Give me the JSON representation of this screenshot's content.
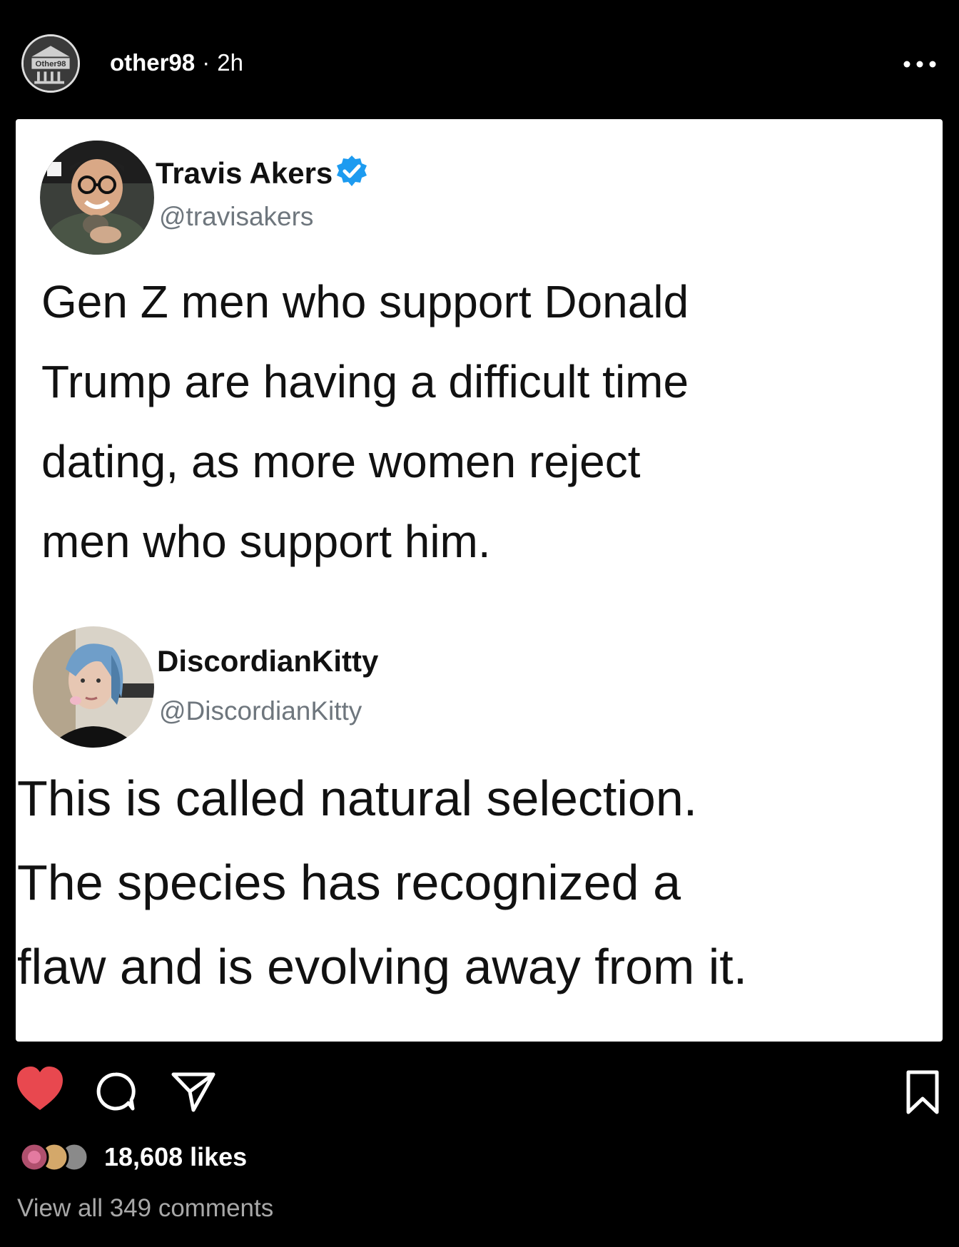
{
  "post": {
    "username": "other98",
    "separator": "·",
    "time_ago": "2h",
    "avatar_text": "Other98"
  },
  "tweets": [
    {
      "name": "Travis Akers",
      "verified": true,
      "handle": "@travisakers",
      "text": "Gen Z men who support Donald\nTrump are having a difficult time\ndating, as more women reject\nmen who support him."
    },
    {
      "name": "DiscordianKitty",
      "verified": false,
      "handle": "@DiscordianKitty",
      "text": "This is called natural selection.\nThe species has recognized a\nflaw and is evolving away from it."
    }
  ],
  "engagement": {
    "likes_label": "18,608 likes",
    "comments_label": "View all 349 comments"
  },
  "icons": {
    "more": "more-horizontal-icon",
    "like": "heart-icon",
    "comment": "comment-icon",
    "share": "send-icon",
    "save": "bookmark-icon",
    "verified": "verified-badge-icon"
  },
  "colors": {
    "background": "#000000",
    "card": "#ffffff",
    "like_active": "#e8484f",
    "verified": "#1d9bf0",
    "handle": "#6e767d",
    "muted": "#a8a8a8"
  }
}
